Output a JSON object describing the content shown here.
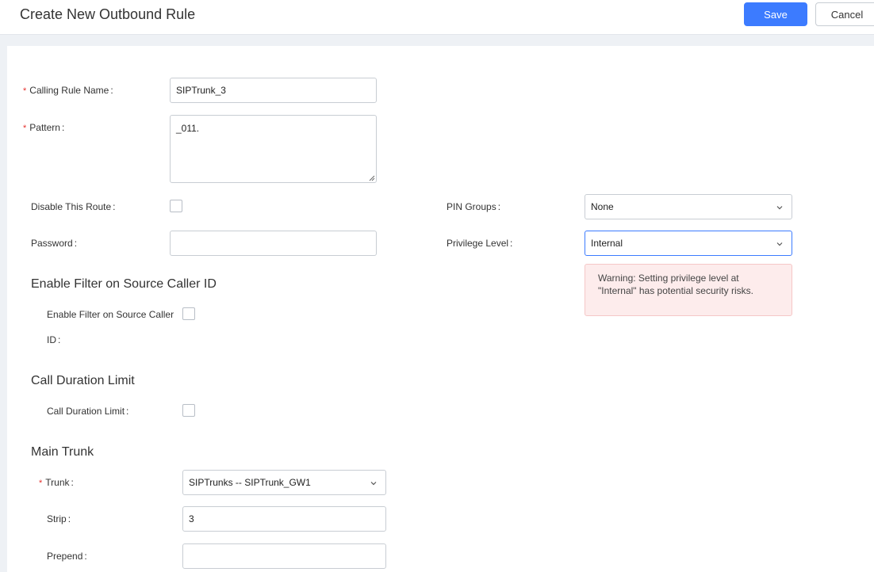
{
  "header": {
    "title": "Create New Outbound Rule",
    "save_label": "Save",
    "cancel_label": "Cancel"
  },
  "form": {
    "calling_rule_name": {
      "label": "Calling Rule Name",
      "value": "SIPTrunk_3",
      "required": true
    },
    "pattern": {
      "label": "Pattern",
      "value": "_011.",
      "required": true
    },
    "disable_route": {
      "label": "Disable This Route",
      "checked": false
    },
    "password": {
      "label": "Password",
      "value": ""
    },
    "pin_groups": {
      "label": "PIN Groups",
      "value": "None"
    },
    "privilege_level": {
      "label": "Privilege Level",
      "value": "Internal"
    },
    "warning": "Warning: Setting privilege level at \"Internal\" has potential security risks."
  },
  "filter_section": {
    "title": "Enable Filter on Source Caller ID",
    "label_line1": "Enable Filter on Source Caller",
    "label_line2": "ID",
    "checked": false
  },
  "duration_section": {
    "title": "Call Duration Limit",
    "label": "Call Duration Limit",
    "checked": false
  },
  "main_trunk": {
    "title": "Main Trunk",
    "trunk": {
      "label": "Trunk",
      "value": "SIPTrunks -- SIPTrunk_GW1",
      "required": true
    },
    "strip": {
      "label": "Strip",
      "value": "3"
    },
    "prepend": {
      "label": "Prepend",
      "value": ""
    }
  },
  "colors": {
    "accent": "#3c7bff",
    "required": "#e5302c",
    "warning_bg": "#fdecec"
  },
  "icons": {
    "select_arrow": "chevron-down-icon"
  }
}
